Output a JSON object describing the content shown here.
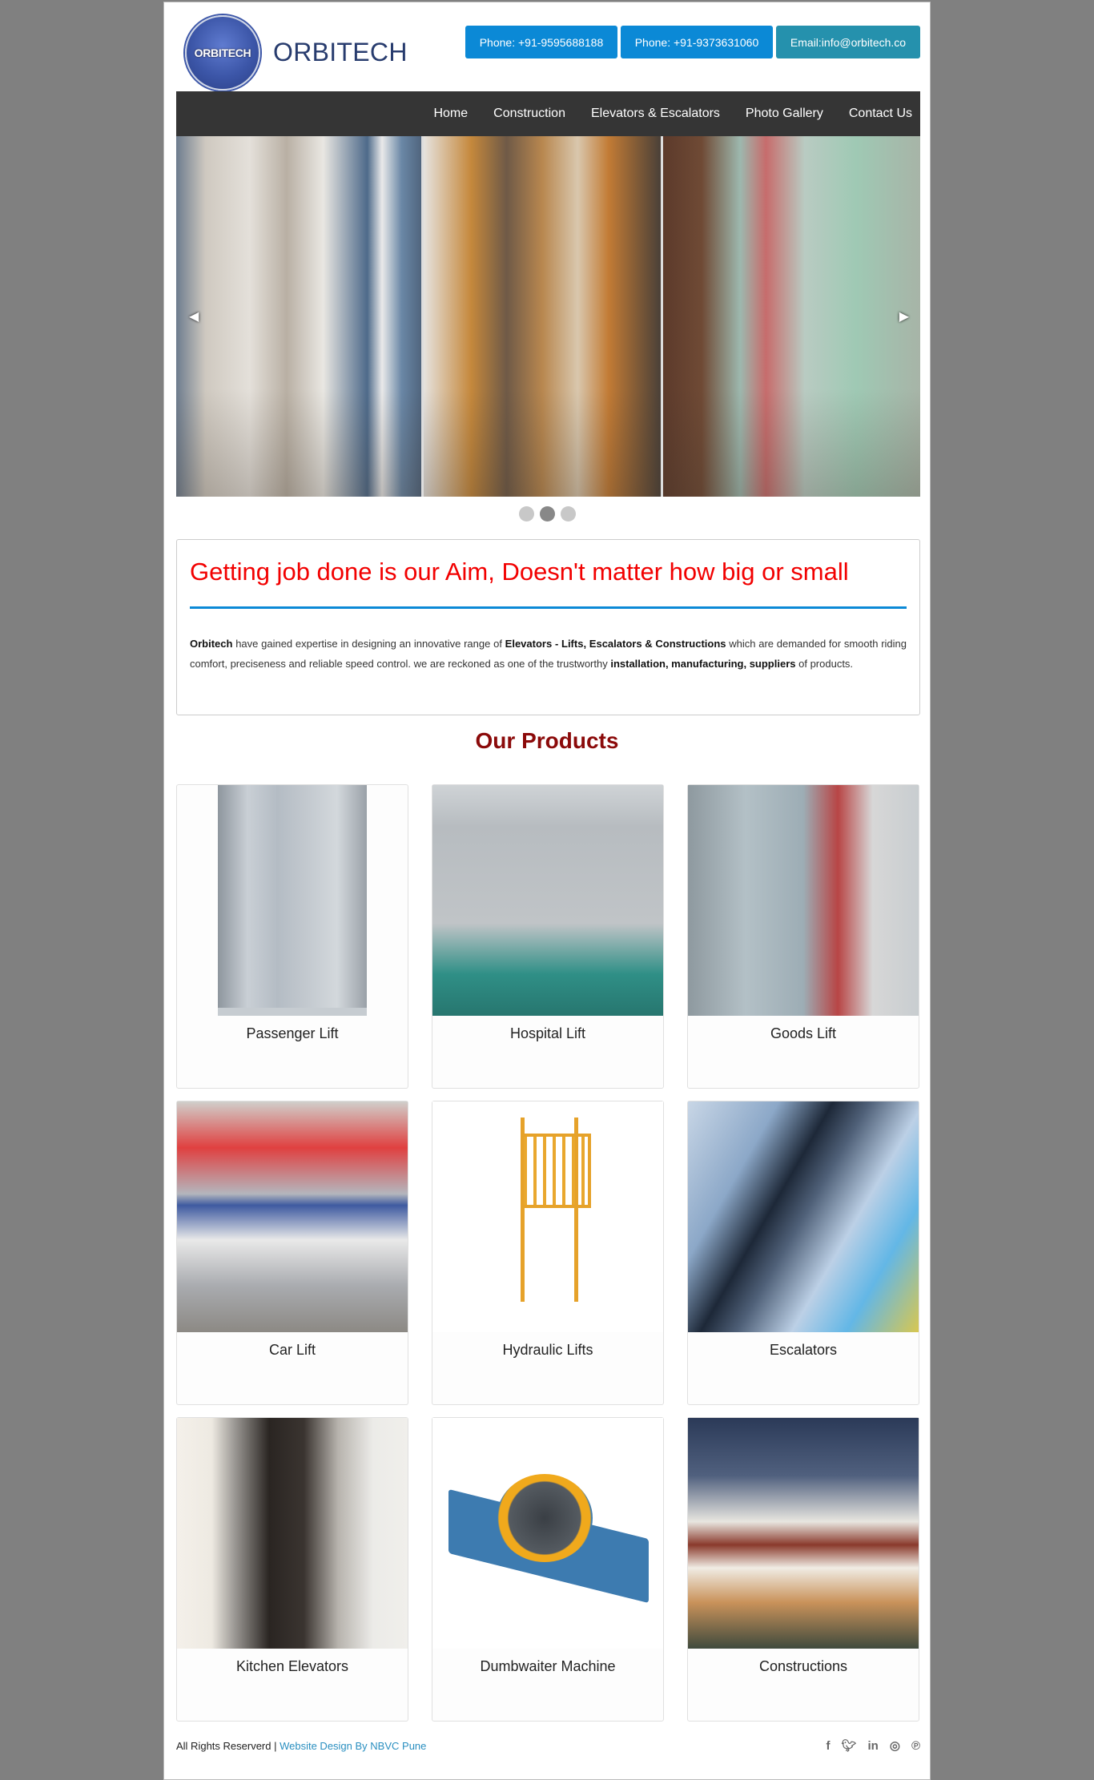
{
  "brand": {
    "logo_text": "ORBITECH",
    "name": "ORBITECH"
  },
  "header": {
    "buttons": [
      {
        "label": "Phone: +91-9595688188",
        "color": "#0b89d6"
      },
      {
        "label": "Phone: +91-9373631060",
        "color": "#0b89d6"
      },
      {
        "label": "Email:info@orbitech.co",
        "color": "#2591ad"
      }
    ]
  },
  "nav": {
    "items": [
      "Home",
      "Construction",
      "Elevators & Escalators",
      "Photo Gallery",
      "Contact Us"
    ]
  },
  "slider": {
    "prev_icon": "◀",
    "next_icon": "▶",
    "slides": [
      "elevator-interior",
      "wooden-glass-lift",
      "home-lift-bedroom"
    ],
    "dots": 3,
    "active_dot": 2
  },
  "intro": {
    "heading": "Getting job done is our Aim, Doesn't matter how big or small",
    "p_strong1": "Orbitech",
    "p_text1": " have gained expertise in designing an innovative range of ",
    "p_strong2": "Elevators - Lifts, Escalators & Constructions",
    "p_text2": " which are demanded for smooth riding comfort, preciseness and reliable speed control. we are reckoned as one of the trustworthy ",
    "p_strong3": "installation, manufacturing, suppliers",
    "p_text3": " of products.",
    "heading_color": "#f20000",
    "rule_color": "#0b89d6"
  },
  "products": {
    "title": "Our Products",
    "items": [
      {
        "name": "Passenger Lift"
      },
      {
        "name": "Hospital Lift"
      },
      {
        "name": "Goods Lift"
      },
      {
        "name": "Car Lift"
      },
      {
        "name": "Hydraulic Lifts"
      },
      {
        "name": "Escalators"
      },
      {
        "name": "Kitchen Elevators"
      },
      {
        "name": "Dumbwaiter Machine"
      },
      {
        "name": "Constructions"
      }
    ]
  },
  "footer": {
    "rights": "All Rights Reserverd | ",
    "credit_link": "Website Design By NBVC Pune",
    "social": [
      {
        "name": "facebook",
        "glyph": "f"
      },
      {
        "name": "twitter",
        "glyph": "🐦︎"
      },
      {
        "name": "linkedin",
        "glyph": "in"
      },
      {
        "name": "instagram",
        "glyph": "◎"
      },
      {
        "name": "pinterest",
        "glyph": "℗"
      }
    ]
  }
}
